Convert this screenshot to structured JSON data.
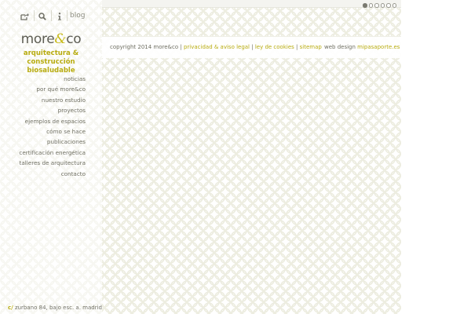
{
  "toolbar": {
    "share_icon": "share-icon",
    "search_icon": "search-icon",
    "info_icon": "info-icon",
    "blog_label": "blog"
  },
  "brand": {
    "logo_part1": "more",
    "logo_amp": "&",
    "logo_part2": "co",
    "tagline_line1": "arquitectura & construcción",
    "tagline_line2": "biosaludable"
  },
  "nav": {
    "items": [
      "noticias",
      "por qué more&co",
      "nuestro estudio",
      "proyectos",
      "ejemplos de espacios",
      "cómo se hace",
      "publicaciones",
      "certificación energética",
      "talleres de arquitectura",
      "contacto"
    ]
  },
  "address": {
    "symbol": "c/",
    "text": " zurbano 84, bajo esc. a. madrid"
  },
  "slider": {
    "active_index": 0,
    "dot_count": 6
  },
  "footer": {
    "copyright": "copyright 2014 more&co | ",
    "link_privacy": "privacidad & aviso legal",
    "sep1": " | ",
    "link_cookies": "ley de cookies",
    "sep2": " | ",
    "link_sitemap": "sitemap",
    "webdesign_label": "web design ",
    "webdesign_link": "mipasaporte.es"
  },
  "colors": {
    "accent": "#b8ac10",
    "text": "#6f6f62"
  }
}
